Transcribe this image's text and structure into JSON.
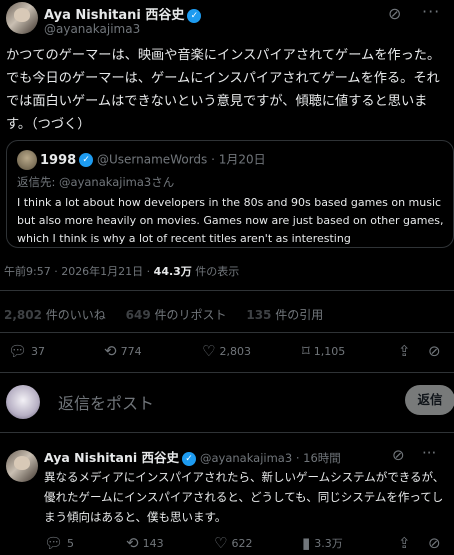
{
  "post": {
    "author_name": "Aya Nishitani 西谷史",
    "author_handle": "@ayanakajima3",
    "text": "かつてのゲーマーは、映画や音楽にインスパイアされてゲームを作った。\nでも今日のゲーマーは、ゲームにインスパイアされてゲームを作る。それでは面白いゲームはできないという意見ですが、傾聴に値すると思います。（つづく）",
    "time": "午前9:57 · 2026年1月21日 · ",
    "views_count": "44.3万",
    "views_label": " 件の表示"
  },
  "quote": {
    "author_name": "1998",
    "author_handle": "@UsernameWords",
    "date": " · 1月20日",
    "reply_to": "返信先: @ayanakajima3さん",
    "text": "I think a lot about how developers in the 80s and 90s based games on music but also more heavily on movies. Games now are just based on other games, which I think is why a lot of recent titles aren't as interesting"
  },
  "stats": {
    "likes_count": "2,802",
    "likes_label": " 件のいいね",
    "reposts_count": "649",
    "reposts_label": " 件のリポスト",
    "quotes_count": "135",
    "quotes_label": " 件の引用"
  },
  "actions": {
    "replies": "37",
    "reposts": "774",
    "likes": "2,803",
    "bookmarks": "1,105"
  },
  "reply_box": {
    "placeholder": "返信をポスト",
    "button": "返信"
  },
  "reply_post": {
    "author_name": "Aya Nishitani 西谷史",
    "author_handle": "@ayanakajima3",
    "time": " · 16時間",
    "text": "異なるメディアにインスパイアされたら、新しいゲームシステムができるが、優れたゲームにインスパイアされると、どうしても、同じシステムを作ってしまう傾向はあると、僕も思います。",
    "replies": "5",
    "reposts": "143",
    "likes": "622",
    "views": "3.3万"
  },
  "icons": {
    "verified": "verified-badge-icon",
    "grok": "grok-icon",
    "more": "more-icon",
    "reply": "reply-icon",
    "repost": "repost-icon",
    "like": "heart-icon",
    "bookmark": "bookmark-icon",
    "share": "share-icon",
    "block": "block-icon",
    "views": "views-icon"
  },
  "colors": {
    "accent": "#1d9bf0",
    "muted": "#71767b",
    "background": "#000000"
  }
}
